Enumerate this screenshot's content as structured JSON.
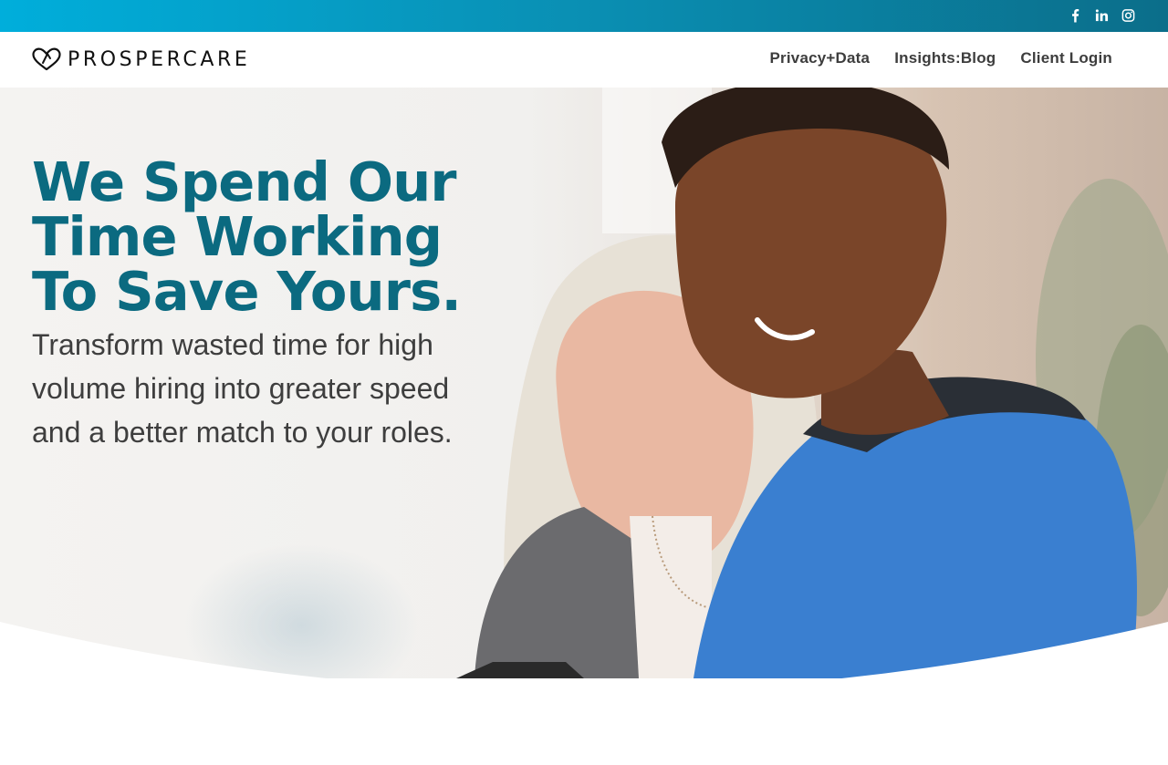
{
  "social": [
    {
      "icon": "facebook-icon"
    },
    {
      "icon": "linkedin-icon"
    },
    {
      "icon": "instagram-icon"
    }
  ],
  "logo": {
    "text": "PROSPERCARE"
  },
  "nav": {
    "items": [
      {
        "label": "Privacy+Data"
      },
      {
        "label": "Insights:Blog"
      },
      {
        "label": "Client Login"
      }
    ]
  },
  "hero": {
    "headline": "We Spend Our Time Working To Save Yours.",
    "subheadline": "Transform wasted time for high volume hiring into greater speed and a better match to your roles."
  },
  "colors": {
    "topbar_start": "#00aedb",
    "topbar_end": "#0b6e8a",
    "headline": "#0b6a80",
    "body_text": "#3e3e3e",
    "scrubs": "#3a7fd0"
  }
}
